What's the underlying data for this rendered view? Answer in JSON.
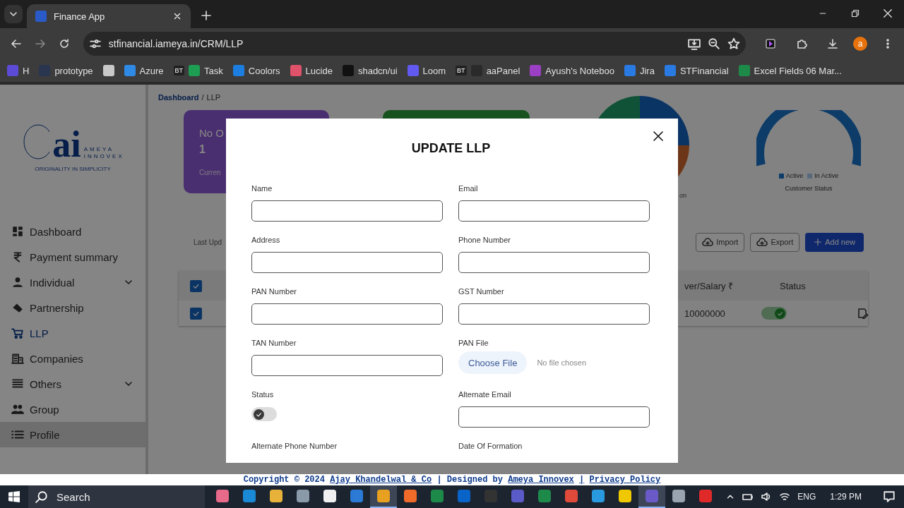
{
  "browser": {
    "tab": {
      "title": "Finance App"
    },
    "url": "stfinancial.iameya.in/CRM/LLP",
    "avatar": "a",
    "bookmarks": [
      {
        "label": "H",
        "color": "#5b4bd6"
      },
      {
        "label": "prototype",
        "color": "#2a3550"
      },
      {
        "color": "#c8c8c8"
      },
      {
        "label": "Azure",
        "color": "#2f8ae6"
      },
      {
        "label": "Task",
        "color": "#1e9e52",
        "badge": "BT"
      },
      {
        "label": "Coolors",
        "color": "#1c7ee0"
      },
      {
        "label": "Lucide",
        "color": "#e0526a"
      },
      {
        "label": "shadcn/ui",
        "color": "#111111"
      },
      {
        "label": "Loom",
        "color": "#6259f0"
      },
      {
        "label": "aaPanel",
        "color": "#2a2a2a",
        "badge": "BT"
      },
      {
        "label": "Ayush's Noteboo",
        "color": "#9b3fc4"
      },
      {
        "label": "Jira",
        "color": "#2a7ae4"
      },
      {
        "label": "STFinancial",
        "color": "#2a7ae4"
      },
      {
        "label": "Excel Fields 06 Mar...",
        "color": "#1e8a4a"
      }
    ]
  },
  "sidebar": {
    "logo": {
      "mark": "ai",
      "name_1": "AMEYA",
      "name_2": "INNOVEX",
      "tagline": "ORIGINALITY IN SIMPLICITY"
    },
    "items": [
      {
        "label": "Dashboard",
        "kind": "link",
        "selected": false,
        "hovered": false
      },
      {
        "label": "Payment summary",
        "kind": "link",
        "selected": false,
        "hovered": false
      },
      {
        "label": "Individual",
        "kind": "group",
        "selected": false,
        "hovered": false
      },
      {
        "label": "Partnership",
        "kind": "link",
        "selected": false,
        "hovered": false
      },
      {
        "label": "LLP",
        "kind": "link",
        "selected": true,
        "hovered": false
      },
      {
        "label": "Companies",
        "kind": "link",
        "selected": false,
        "hovered": false
      },
      {
        "label": "Others",
        "kind": "group",
        "selected": false,
        "hovered": false
      },
      {
        "label": "Group",
        "kind": "link",
        "selected": false,
        "hovered": false
      },
      {
        "label": "Profile",
        "kind": "link",
        "selected": false,
        "hovered": true
      }
    ]
  },
  "breadcrumb": {
    "items": [
      "Dashboard",
      "LLP"
    ],
    "separator": "/"
  },
  "cards": [
    {
      "kind": "stat",
      "title": "No O",
      "value": "1",
      "note": "Curren"
    },
    {
      "kind": "plain"
    }
  ],
  "pie_caption": "on",
  "gauge": {
    "legend": [
      {
        "label": "Active"
      },
      {
        "label": "In Active"
      }
    ],
    "caption": "Customer Status"
  },
  "toolbar": {
    "last_updated": "Last Upd",
    "buttons": [
      {
        "label": "Import",
        "kind": "outline"
      },
      {
        "label": "Export",
        "kind": "outline"
      },
      {
        "label": "Add new",
        "kind": "primary"
      }
    ]
  },
  "table": {
    "header_checked": true,
    "columns": [
      "ver/Salary ₹",
      "Status"
    ],
    "rows": [
      {
        "checked": true,
        "amount": "10000000",
        "status_on": true
      }
    ]
  },
  "modal": {
    "title": "UPDATE LLP",
    "fields": [
      {
        "label": "Name",
        "kind": "text"
      },
      {
        "label": "Email",
        "kind": "text"
      },
      {
        "label": "Address",
        "kind": "text"
      },
      {
        "label": "Phone Number",
        "kind": "text"
      },
      {
        "label": "PAN Number",
        "kind": "text"
      },
      {
        "label": "GST Number",
        "kind": "text"
      },
      {
        "label": "TAN Number",
        "kind": "text"
      },
      {
        "label": "PAN File",
        "kind": "file",
        "button": "Choose File",
        "note": "No file chosen"
      },
      {
        "label": "Status",
        "kind": "toggle",
        "on": false
      },
      {
        "label": "Alternate Email",
        "kind": "text"
      },
      {
        "label": "Alternate Phone Number",
        "kind": "label"
      },
      {
        "label": "Date Of Formation",
        "kind": "label"
      }
    ]
  },
  "footer": [
    {
      "text": "Copyright © 2024",
      "kind": "text"
    },
    {
      "text": "Ajay Khandelwal & Co",
      "kind": "link"
    },
    {
      "text": "| Designed by",
      "kind": "text"
    },
    {
      "text": "Ameya Innovex",
      "kind": "link"
    },
    {
      "text": "|",
      "kind": "link"
    },
    {
      "text": "Privacy Policy",
      "kind": "link"
    }
  ],
  "taskbar": {
    "search": {
      "placeholder": "Search"
    },
    "apps": [
      {
        "color": "#e86a8a",
        "selected": false
      },
      {
        "color": "#1a8ad6",
        "selected": false
      },
      {
        "color": "#e8b23a",
        "selected": false
      },
      {
        "color": "#8a9aa8",
        "selected": false
      },
      {
        "color": "#f0f0f0",
        "selected": false
      },
      {
        "color": "#2a7ad6",
        "selected": false
      },
      {
        "color": "#e8a020",
        "selected": true
      },
      {
        "color": "#f06a2a",
        "selected": false
      },
      {
        "color": "#1e8a4a",
        "selected": false
      },
      {
        "color": "#0a64c8",
        "selected": false
      },
      {
        "color": "#333333",
        "selected": false
      },
      {
        "color": "#5a5ac8",
        "selected": false
      },
      {
        "color": "#1e8a4a",
        "selected": false
      },
      {
        "color": "#e04a3a",
        "selected": false
      },
      {
        "color": "#2a9ae0",
        "selected": false
      },
      {
        "color": "#f0c800",
        "selected": false
      },
      {
        "color": "#6a5ac8",
        "selected": true
      },
      {
        "color": "#9aa4b0",
        "selected": false
      },
      {
        "color": "#e02a2a",
        "selected": false
      }
    ],
    "language": "ENG",
    "time": "1:29 PM"
  }
}
